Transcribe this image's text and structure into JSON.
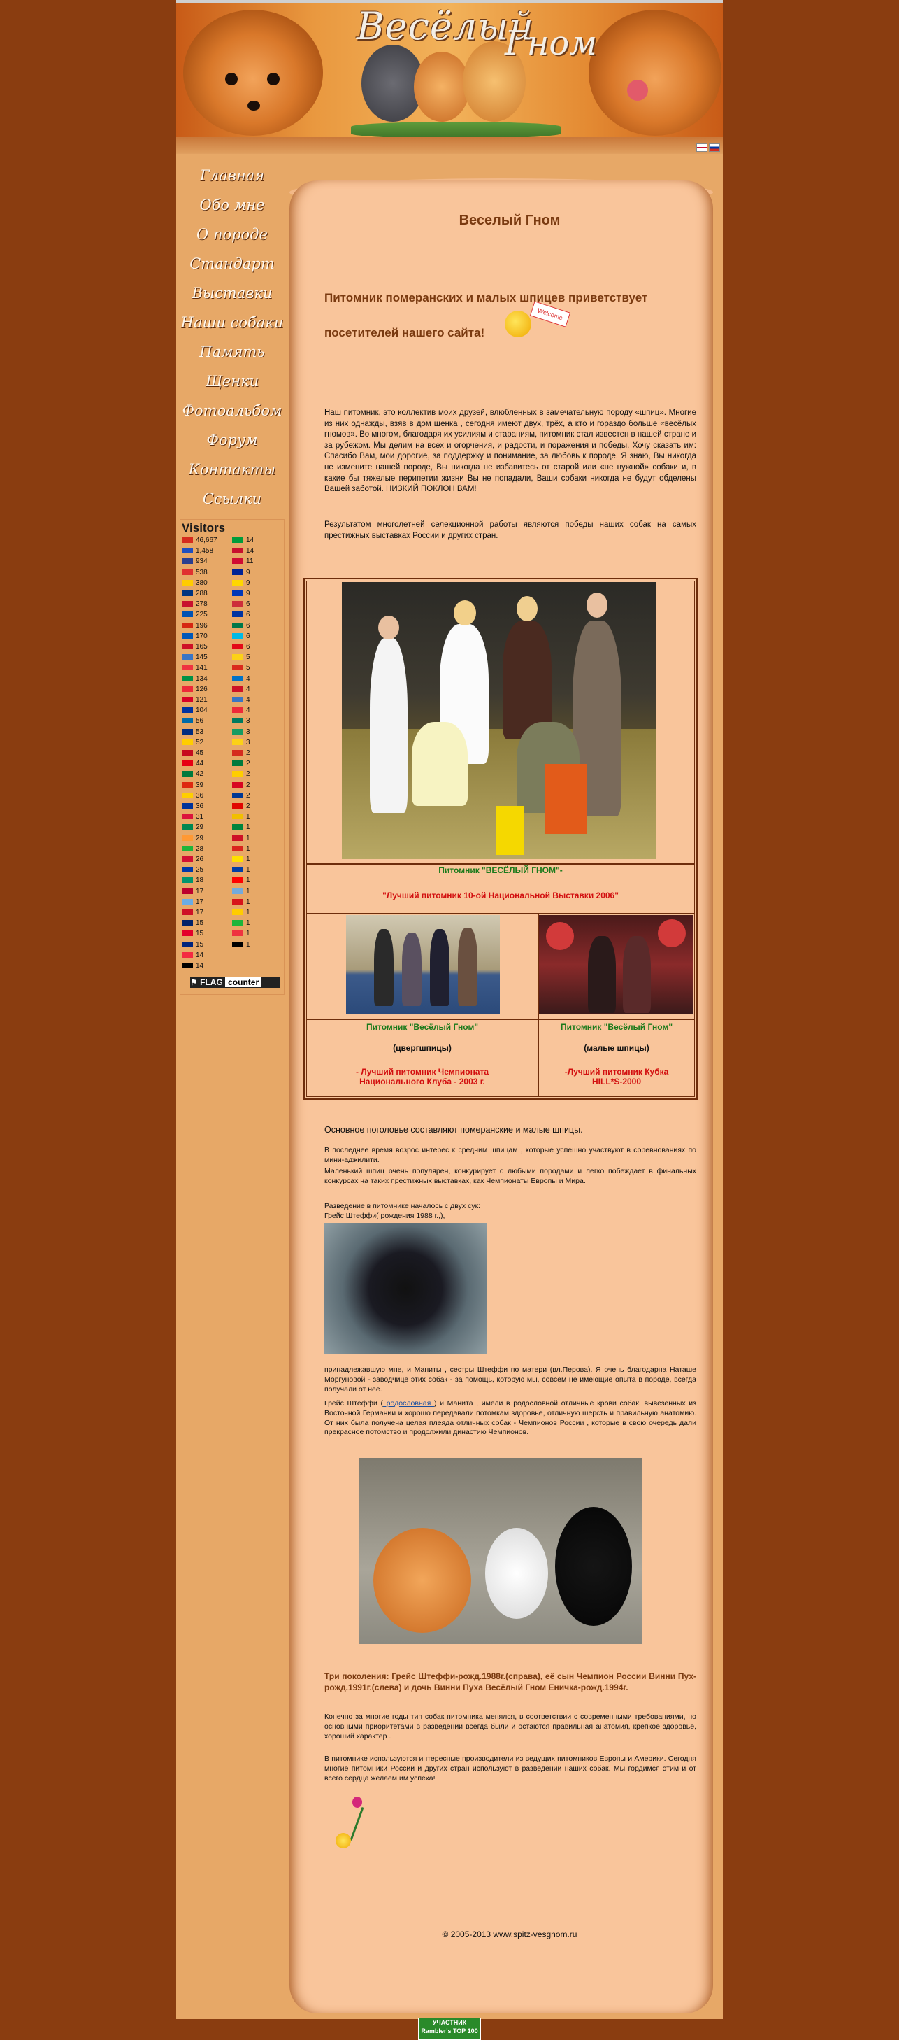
{
  "banner": {
    "title_part1": "Весёлый",
    "title_part2": "Гном"
  },
  "menu": [
    "Главная",
    "Обо мне",
    "О породе",
    "Стандарт",
    "Выставки",
    "Наши собаки",
    "Память",
    "Щенки",
    "Фотоальбом",
    "Форум",
    "Контакты",
    "Ссылки"
  ],
  "visitors": {
    "title": "Visitors",
    "left": [
      {
        "c": "#d52b1e",
        "n": "46,667"
      },
      {
        "c": "#1f4fbf",
        "n": "1,458"
      },
      {
        "c": "#2a3f8f",
        "n": "934"
      },
      {
        "c": "#e03030",
        "n": "538"
      },
      {
        "c": "#ffcc00",
        "n": "380"
      },
      {
        "c": "#003580",
        "n": "288"
      },
      {
        "c": "#c8102e",
        "n": "278"
      },
      {
        "c": "#0052b4",
        "n": "225"
      },
      {
        "c": "#d62612",
        "n": "196"
      },
      {
        "c": "#0057b7",
        "n": "170"
      },
      {
        "c": "#ce1126",
        "n": "165"
      },
      {
        "c": "#3a75c4",
        "n": "145"
      },
      {
        "c": "#ef3340",
        "n": "141"
      },
      {
        "c": "#009246",
        "n": "134"
      },
      {
        "c": "#ed2939",
        "n": "126"
      },
      {
        "c": "#d80027",
        "n": "121"
      },
      {
        "c": "#0033a0",
        "n": "104"
      },
      {
        "c": "#006aa7",
        "n": "56"
      },
      {
        "c": "#002b7f",
        "n": "53"
      },
      {
        "c": "#ffcd00",
        "n": "52"
      },
      {
        "c": "#c60b1e",
        "n": "45"
      },
      {
        "c": "#e70013",
        "n": "44"
      },
      {
        "c": "#007a3d",
        "n": "42"
      },
      {
        "c": "#de2910",
        "n": "39"
      },
      {
        "c": "#ffce00",
        "n": "36"
      },
      {
        "c": "#003399",
        "n": "36"
      },
      {
        "c": "#dc143c",
        "n": "31"
      },
      {
        "c": "#008751",
        "n": "29"
      },
      {
        "c": "#ff9933",
        "n": "29"
      },
      {
        "c": "#1eb53a",
        "n": "28"
      },
      {
        "c": "#d21034",
        "n": "26"
      },
      {
        "c": "#0038a8",
        "n": "25"
      },
      {
        "c": "#00966e",
        "n": "18"
      },
      {
        "c": "#bc002d",
        "n": "17"
      },
      {
        "c": "#6cace4",
        "n": "17"
      },
      {
        "c": "#ce1126",
        "n": "17"
      },
      {
        "c": "#012169",
        "n": "15"
      },
      {
        "c": "#e4002b",
        "n": "15"
      },
      {
        "c": "#00247d",
        "n": "15"
      },
      {
        "c": "#f42a41",
        "n": "14"
      },
      {
        "c": "#000000",
        "n": "14"
      }
    ],
    "right": [
      {
        "c": "#009c3b",
        "n": "14"
      },
      {
        "c": "#c8102e",
        "n": "14"
      },
      {
        "c": "#d00c33",
        "n": "11"
      },
      {
        "c": "#002395",
        "n": "9"
      },
      {
        "c": "#ffd700",
        "n": "9"
      },
      {
        "c": "#0038b8",
        "n": "9"
      },
      {
        "c": "#cd2e3a",
        "n": "6"
      },
      {
        "c": "#0033a0",
        "n": "6"
      },
      {
        "c": "#007749",
        "n": "6"
      },
      {
        "c": "#00b9e4",
        "n": "6"
      },
      {
        "c": "#e30a17",
        "n": "6"
      },
      {
        "c": "#fcd116",
        "n": "5"
      },
      {
        "c": "#da291c",
        "n": "5"
      },
      {
        "c": "#0072c6",
        "n": "4"
      },
      {
        "c": "#ce1126",
        "n": "4"
      },
      {
        "c": "#3a75c4",
        "n": "4"
      },
      {
        "c": "#ed2939",
        "n": "4"
      },
      {
        "c": "#007a5e",
        "n": "3"
      },
      {
        "c": "#169b62",
        "n": "3"
      },
      {
        "c": "#fcd116",
        "n": "3"
      },
      {
        "c": "#d52b1e",
        "n": "2"
      },
      {
        "c": "#007a3d",
        "n": "2"
      },
      {
        "c": "#ffce00",
        "n": "2"
      },
      {
        "c": "#d80621",
        "n": "2"
      },
      {
        "c": "#003893",
        "n": "2"
      },
      {
        "c": "#e10600",
        "n": "2"
      },
      {
        "c": "#f1bf00",
        "n": "1"
      },
      {
        "c": "#00843d",
        "n": "1"
      },
      {
        "c": "#ce1126",
        "n": "1"
      },
      {
        "c": "#da251d",
        "n": "1"
      },
      {
        "c": "#fedf00",
        "n": "1"
      },
      {
        "c": "#003da5",
        "n": "1"
      },
      {
        "c": "#ff0000",
        "n": "1"
      },
      {
        "c": "#75aadb",
        "n": "1"
      },
      {
        "c": "#d7141a",
        "n": "1"
      },
      {
        "c": "#ffcc00",
        "n": "1"
      },
      {
        "c": "#1eb53a",
        "n": "1"
      },
      {
        "c": "#ef3340",
        "n": "1"
      },
      {
        "c": "#000000",
        "n": "1"
      }
    ],
    "counter_label_a": "FLAG",
    "counter_label_b": "counter"
  },
  "main": {
    "title": "Веселый Гном",
    "greeting_line1": "Питомник померанских и малых шпицев приветствует",
    "greeting_line2": "посетителей нашего сайта!",
    "welcome_sign": "Welcome",
    "intro": "Наш питомник, это коллектив моих друзей, влюбленных в замечательную породу «шпиц». Многие из них однажды, взяв в дом щенка , сегодня имеют двух, трёх, а кто и гораздо больше «весёлых гномов». Во многом, благодаря их усилиям и стараниям, питомник стал известен в нашей стране и за рубежом. Мы делим на всех и огорчения, и радости, и поражения и победы. Хочу сказать им: Спасибо Вам, мои дорогие, за поддержку и понимание, за любовь к породе. Я знаю, Вы никогда не измените нашей породе, Вы никогда не избавитесь от старой или «не нужной» собаки и, в какие бы тяжелые перипетии жизни Вы не попадали, Ваши собаки никогда не будут обделены Вашей заботой. НИЗКИЙ ПОКЛОН ВАМ!",
    "results": "Результатом многолетней селекционной работы являются победы наших собак на самых престижных выставках России и других стран.",
    "big_caption_green": "Питомник \"ВЕСЁЛЫЙ ГНОМ\"-",
    "big_caption_red": "\"Лучший питомник 10-ой Национальной Выставки 2006\"",
    "left_caption_green": "Питомник \"Весёлый Гном\"",
    "left_caption_black": "(цвергшпицы)",
    "left_caption_red": "- Лучший питомник Чемпионата Национального Клуба - 2003 г.",
    "right_caption_green": "Питомник \"Весёлый Гном\"",
    "right_caption_black": "(малые шпицы)",
    "right_caption_red": "-Лучший питомник Кубка HILL*S-2000",
    "livestock": "Основное поголовье составляют померанские и малые шпицы.",
    "interest": "В последнее время возрос интерес к средним шпицам , которые успешно участвуют в соревнованиях по мини-аджилити.",
    "small_spitz": "Маленький шпиц очень популярен, конкурирует с любыми породами и легко побеждает в финальных конкурсах на таких престижных выставках, как Чемпионаты Европы и Мира.",
    "breeding_start": "Разведение в питомнике началось с двух сук:",
    "grace_line": "Грейс Штеффи( рождения 1988 г.,),",
    "owned": "принадлежавшую мне, и Маниты , сестры Штеффи по матери (вл.Перова). Я очень благодарна Наташе Моргуновой - заводчице этих собак - за помощь, которую мы, совсем не имеющие опыта в породе, всегда получали от неё.",
    "pedigree_pre": "Грейс Штеффи (",
    "pedigree_link": " родословная ",
    "pedigree_post": ") и Манита , имели в родословной отличные крови собак, вывезенных из Восточной Германии и хорошо передавали потомкам здоровье, отличную шерсть и правильную анатомию. От них была получена целая плеяда отличных собак - Чемпионов России , которые в свою очередь дали прекрасное потомство и продолжили династию Чемпионов.",
    "generations": "Три поколения: Грейс Штеффи-рожд.1988г.(справа), её сын Чемпион России Винни Пух- рожд.1991г.(слева) и дочь Винни Пуха Весёлый Гном Еничка-рожд.1994г.",
    "type_changed": "Конечно за многие годы тип собак питомника менялся, в соответствии с современными требованиями, но основными приоритетами в разведении всегда были и остаются правильная анатомия, крепкое здоровье, хороший характер .",
    "producers": "В питомнике используются интересные производители из ведущих питомников Европы и Америки. Сегодня многие питомники России и других стран используют в разведении наших собак. Мы гордимся этим и от всего сердца желаем им успеха!",
    "copyright": "© 2005-2013 www.spitz-vesgnom.ru",
    "badge_line1": "УЧАСТНИК",
    "badge_line2": "Rambler's TOP 100"
  }
}
